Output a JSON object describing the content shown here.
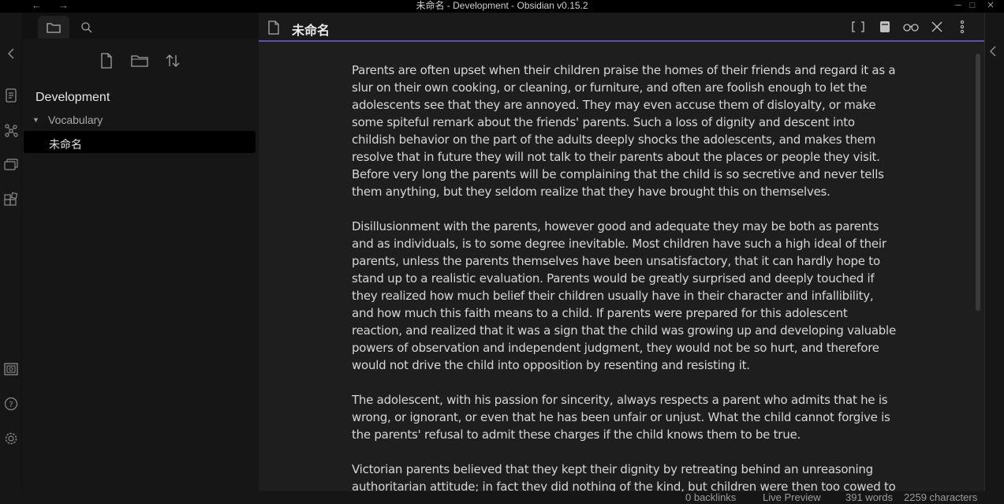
{
  "window": {
    "title": "未命名 - Development - Obsidian v0.15.2",
    "back": "←",
    "forward": "→",
    "minimize": "─",
    "maximize": "□",
    "close": "✕"
  },
  "ribbon": {
    "icons": [
      "collapse-left-icon",
      "switcher-icon",
      "graph-icon",
      "slides-icon",
      "plugins-icon",
      "vault-icon",
      "help-icon",
      "settings-icon"
    ]
  },
  "sidebar": {
    "tabs": [
      "file-explorer",
      "search"
    ],
    "actions": [
      "new-note",
      "new-folder",
      "sort"
    ],
    "vault_name": "Development",
    "folder": "Vocabulary",
    "file": "未命名"
  },
  "editor": {
    "title": "未命名",
    "paragraphs": [
      "Parents are often upset when their children praise the homes of their friends and regard it as a slur on their own cooking, or cleaning, or furniture, and often are foolish enough to let the adolescents see that they are annoyed. They may even accuse them of disloyalty, or make some spiteful remark about the friends' parents. Such a loss of dignity and descent into childish behavior on the part of the adults deeply shocks the adolescents, and makes them resolve that in future they will not talk to their parents about the places or people they visit. Before very long the parents will be complaining that the child is so secretive and never tells them anything, but they seldom realize that they have brought this on themselves.",
      "Disillusionment with the parents, however good and adequate they may be both as parents and as individuals, is to some degree inevitable. Most children have such a high ideal of their parents, unless the parents themselves have been unsatisfactory, that it can hardly hope to stand up to a realistic evaluation. Parents would be greatly surprised and deeply touched if they realized how much belief their children usually have in their character and infallibility, and how much this faith means to a child. If parents were prepared for this adolescent reaction, and realized that it was a sign that the child was growing up and developing valuable powers of observation and independent judgment, they would not be so hurt, and therefore would not drive the child into opposition by resenting and resisting it.",
      "The adolescent, with his passion for sincerity, always respects a parent who admits that he is wrong, or ignorant, or even that he has been unfair or unjust. What the child cannot forgive is the parents' refusal to admit these charges if the child knows them to be true.",
      "Victorian parents believed that they kept their dignity by retreating behind an unreasoning authoritarian attitude; in fact they did nothing of the kind, but children were then too cowed to"
    ]
  },
  "status": {
    "backlinks": "0 backlinks",
    "mode": "Live Preview",
    "words": "391 words",
    "characters": "2259 characters"
  },
  "colors": {
    "accent": "#5b4fb5",
    "background": "#1e1e1e",
    "sidebar": "#161616"
  }
}
